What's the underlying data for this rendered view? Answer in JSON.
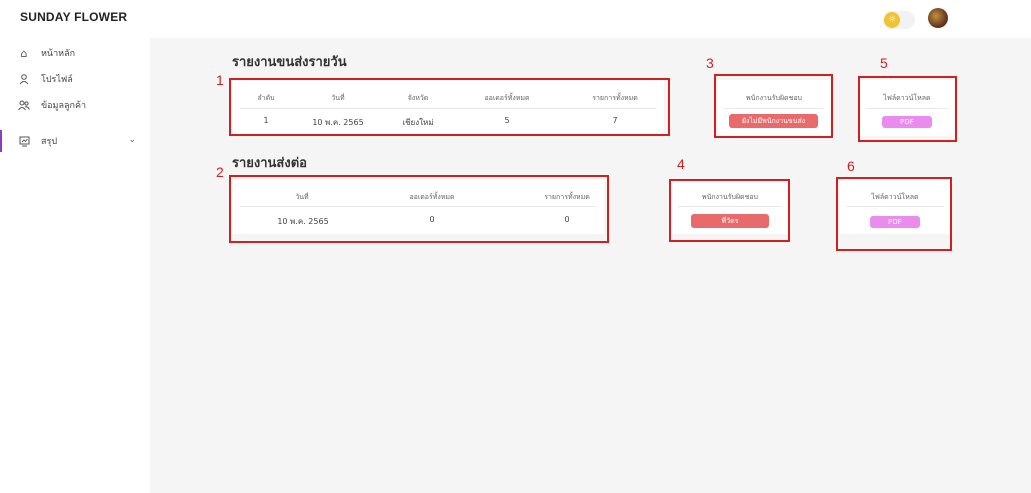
{
  "app": {
    "brand": "SUNDAY FLOWER"
  },
  "header": {
    "toggle_icon": "sun-icon",
    "avatar": "user-avatar"
  },
  "sidebar": {
    "items": [
      {
        "label": "หน้าหลัก",
        "icon": "home-icon"
      },
      {
        "label": "โปรไฟล์",
        "icon": "user-icon"
      },
      {
        "label": "ข้อมูลลูกค้า",
        "icon": "users-icon"
      },
      {
        "label": "สรุป",
        "icon": "report-icon"
      }
    ]
  },
  "daily_report": {
    "title": "รายงานขนส่งรายวัน",
    "headers": [
      "ลำดับ",
      "วันที่",
      "จังหวัด",
      "ออเดอร์ทั้งหมด",
      "รายการทั้งหมด"
    ],
    "rows": [
      {
        "no": "1",
        "date": "10 พ.ค. 2565",
        "province": "เชียงใหม่",
        "orders": "5",
        "items": "7"
      }
    ],
    "staff_header": "พนักงานรับผิดชอบ",
    "staff_button": "ยังไม่มีพนักงานขนส่ง",
    "download_header": "ไฟล์ดาวน์โหลด",
    "download_button": "PDF"
  },
  "forward_report": {
    "title": "รายงานส่งต่อ",
    "headers": [
      "วันที่",
      "ออเดอร์ทั้งหมด",
      "รายการทั้งหมด"
    ],
    "rows": [
      {
        "date": "10 พ.ค. 2565",
        "orders": "0",
        "items": "0"
      }
    ],
    "staff_header": "พนักงานรับผิดชอบ",
    "staff_button": "พี่วัตร",
    "download_header": "ไฟล์ดาวน์โหลด",
    "download_button": "PDF"
  },
  "annotations": [
    "1",
    "2",
    "3",
    "4",
    "5",
    "6"
  ],
  "colors": {
    "annotation": "#d02020",
    "staff_button": "#e86a6a",
    "pdf_button": "#e98ced",
    "active_nav": "#8a3ec6"
  }
}
